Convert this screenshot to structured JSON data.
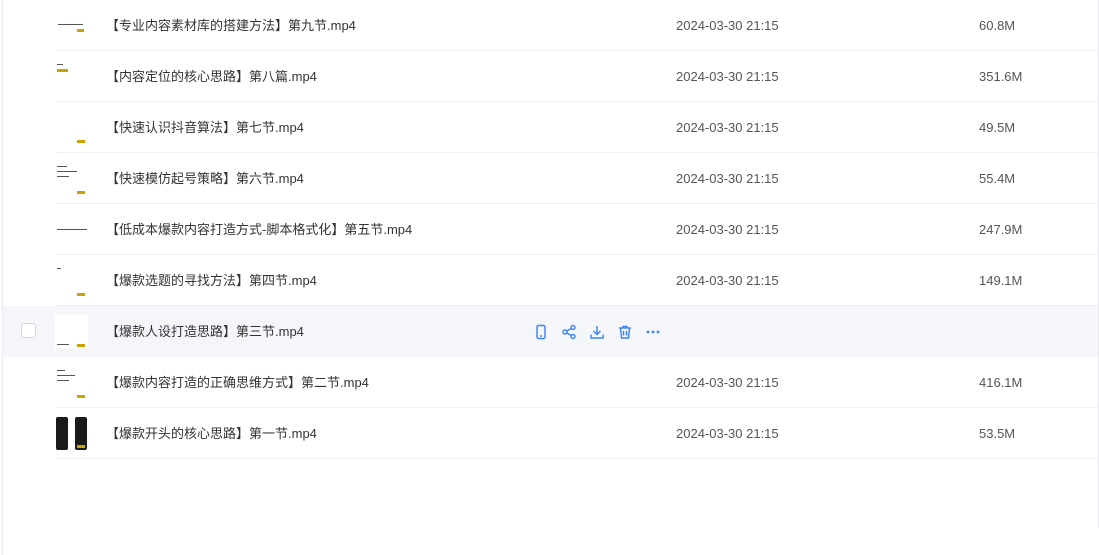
{
  "colors": {
    "accent": "#3b82f6",
    "hover_row": "#f5f6fa",
    "divider": "#eef0f4"
  },
  "row_actions": [
    "phone-icon",
    "share-icon",
    "download-icon",
    "trash-icon",
    "more-icon"
  ],
  "files": [
    {
      "name": "【专业内容素材库的搭建方法】第九节.mp4",
      "date": "2024-03-30 21:15",
      "size": "60.8M"
    },
    {
      "name": "【内容定位的核心思路】第八篇.mp4",
      "date": "2024-03-30 21:15",
      "size": "351.6M"
    },
    {
      "name": "【快速认识抖音算法】第七节.mp4",
      "date": "2024-03-30 21:15",
      "size": "49.5M"
    },
    {
      "name": "【快速模仿起号策略】第六节.mp4",
      "date": "2024-03-30 21:15",
      "size": "55.4M"
    },
    {
      "name": "【低成本爆款内容打造方式-脚本格式化】第五节.mp4",
      "date": "2024-03-30 21:15",
      "size": "247.9M"
    },
    {
      "name": "【爆款选题的寻找方法】第四节.mp4",
      "date": "2024-03-30 21:15",
      "size": "149.1M"
    },
    {
      "name": "【爆款人设打造思路】第三节.mp4",
      "date": "",
      "size": "",
      "hovered": true
    },
    {
      "name": "【爆款内容打造的正确思维方式】第二节.mp4",
      "date": "2024-03-30 21:15",
      "size": "416.1M"
    },
    {
      "name": "【爆款开头的核心思路】第一节.mp4",
      "date": "2024-03-30 21:15",
      "size": "53.5M"
    }
  ]
}
